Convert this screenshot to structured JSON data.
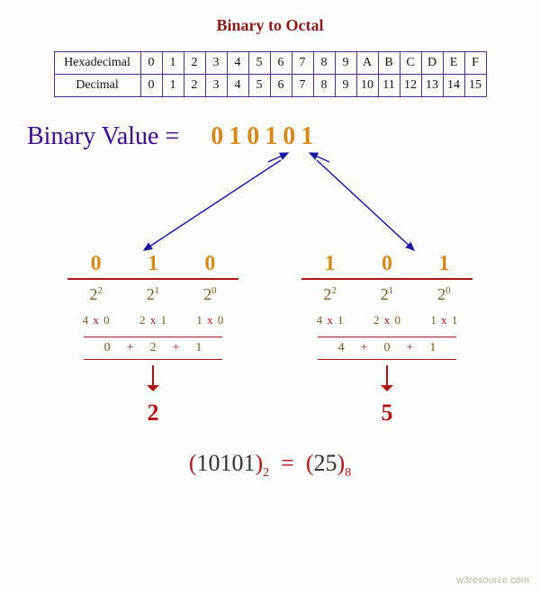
{
  "title": "Binary to Octal",
  "table": {
    "row1_label": "Hexadecimal",
    "row1": [
      "0",
      "1",
      "2",
      "3",
      "4",
      "5",
      "6",
      "7",
      "8",
      "9",
      "A",
      "B",
      "C",
      "D",
      "E",
      "F"
    ],
    "row2_label": "Decimal",
    "row2": [
      "0",
      "1",
      "2",
      "3",
      "4",
      "5",
      "6",
      "7",
      "8",
      "9",
      "10",
      "11",
      "12",
      "13",
      "14",
      "15"
    ]
  },
  "binval": {
    "label": "Binary Value =",
    "digits": "010101"
  },
  "groups": [
    {
      "digits": [
        "0",
        "1",
        "0"
      ],
      "pows_base": "2",
      "pows_exp": [
        "2",
        "1",
        "0"
      ],
      "mults": [
        {
          "a": "4",
          "b": "0"
        },
        {
          "a": "2",
          "b": "1"
        },
        {
          "a": "1",
          "b": "0"
        }
      ],
      "sums": [
        "0",
        "2",
        "1"
      ],
      "result": "2"
    },
    {
      "digits": [
        "1",
        "0",
        "1"
      ],
      "pows_base": "2",
      "pows_exp": [
        "2",
        "1",
        "0"
      ],
      "mults": [
        {
          "a": "4",
          "b": "1"
        },
        {
          "a": "2",
          "b": "0"
        },
        {
          "a": "1",
          "b": "1"
        }
      ],
      "sums": [
        "4",
        "0",
        "1"
      ],
      "result": "5"
    }
  ],
  "equation": {
    "lhs_val": "10101",
    "lhs_base": "2",
    "eq": "=",
    "rhs_val": "25",
    "rhs_base": "8",
    "lp": "(",
    "rp": ")"
  },
  "footer": "w3resource.com"
}
